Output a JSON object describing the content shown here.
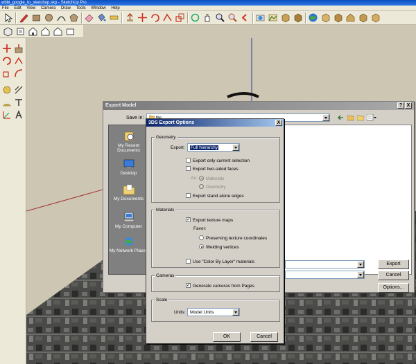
{
  "window": {
    "title": "wbbi_google_to_sketchup.skp - SketchUp Pro"
  },
  "menu": [
    "File",
    "Edit",
    "View",
    "Camera",
    "Draw",
    "Tools",
    "Window",
    "Help"
  ],
  "toolbar_icons": [
    "select-icon",
    "eraser-icon",
    "pencil-icon",
    "rectangle-icon",
    "circle-icon",
    "arc-icon",
    "push-pull-icon",
    "move-icon",
    "rotate-icon",
    "offset-icon",
    "orbit-icon",
    "pan-icon",
    "zoom-icon",
    "zoom-extents-icon",
    "previous-view-icon",
    "get-models-icon",
    "share-model-icon",
    "component-icon",
    "materials-icon",
    "layers-icon",
    "google-earth-icon",
    "get-current-view-icon",
    "toggle-terrain-icon",
    "place-model-icon",
    "export-icon",
    "warehouse-icon",
    "component-folder-icon"
  ],
  "view_icons": [
    "iso-view-icon",
    "top-view-icon",
    "front-view-icon",
    "right-view-icon",
    "back-view-icon",
    "left-view-icon"
  ],
  "export_dialog": {
    "title": "Export Model",
    "help_btn": "?",
    "close_btn": "X",
    "save_in_label": "Save in:",
    "save_in_value": "file",
    "places": [
      "My Recent Documents",
      "Desktop",
      "My Documents",
      "My Computer",
      "My Network Places"
    ],
    "export_btn": "Export",
    "cancel_btn": "Cancel",
    "options_btn": "Options..."
  },
  "options_dialog": {
    "title": "3DS Export Options",
    "close_btn": "X",
    "geometry": {
      "label": "Geometry",
      "export_label": "Export:",
      "export_value": "Full hierarchy",
      "only_selection": "Export only current selection",
      "two_sided": "Export two-sided faces",
      "as_label": "As:",
      "as_materials": "Materials",
      "as_geometry": "Geometry",
      "stand_alone": "Export stand alone edges"
    },
    "materials": {
      "label": "Materials",
      "texture_maps": "Export texture maps",
      "favor_label": "Favor:",
      "preserve": "Preserving texture coordinates",
      "welding": "Welding vertices",
      "color_by_layer": "Use \"Color By Layer\" materials"
    },
    "cameras": {
      "label": "Cameras",
      "from_pages": "Generate cameras from Pages"
    },
    "scale": {
      "label": "Scale",
      "units_label": "Units:",
      "units_value": "Model Units"
    },
    "ok_btn": "OK",
    "cancel_btn": "Cancel"
  }
}
